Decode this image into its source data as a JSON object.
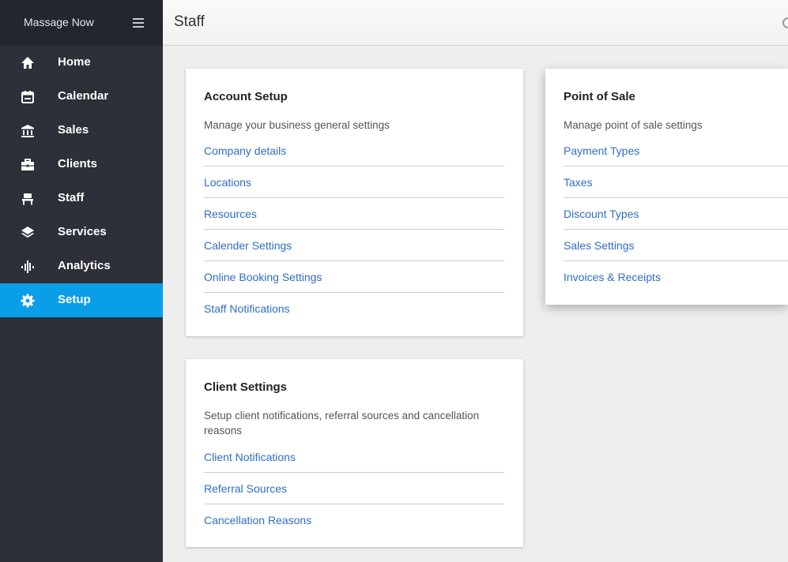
{
  "sidebar": {
    "brand": "Massage Now",
    "items": [
      {
        "label": "Home",
        "icon": "home-icon",
        "active": false
      },
      {
        "label": "Calendar",
        "icon": "calendar-icon",
        "active": false
      },
      {
        "label": "Sales",
        "icon": "bank-icon",
        "active": false
      },
      {
        "label": "Clients",
        "icon": "briefcase-icon",
        "active": false
      },
      {
        "label": "Staff",
        "icon": "chair-icon",
        "active": false
      },
      {
        "label": "Services",
        "icon": "layers-icon",
        "active": false
      },
      {
        "label": "Analytics",
        "icon": "waveform-icon",
        "active": false
      },
      {
        "label": "Setup",
        "icon": "gear-icon",
        "active": true
      }
    ]
  },
  "header": {
    "title": "Staff"
  },
  "cards": {
    "account": {
      "title": "Account Setup",
      "desc": "Manage your business general settings",
      "links": [
        "Company details",
        "Locations",
        "Resources",
        "Calender Settings",
        "Online Booking Settings",
        "Staff Notifications"
      ]
    },
    "pos": {
      "title": "Point of Sale",
      "desc": "Manage point of sale settings",
      "links": [
        "Payment Types",
        "Taxes",
        "Discount Types",
        "Sales Settings",
        "Invoices & Receipts"
      ]
    },
    "client": {
      "title": "Client Settings",
      "desc": "Setup client notifications, referral sources and cancellation reasons",
      "links": [
        "Client Notifications",
        "Referral Sources",
        "Cancellation Reasons"
      ]
    }
  },
  "colors": {
    "sidebar_bg": "#2d3039",
    "active_bg": "#0b9ee8",
    "link": "#2f6dc7"
  }
}
